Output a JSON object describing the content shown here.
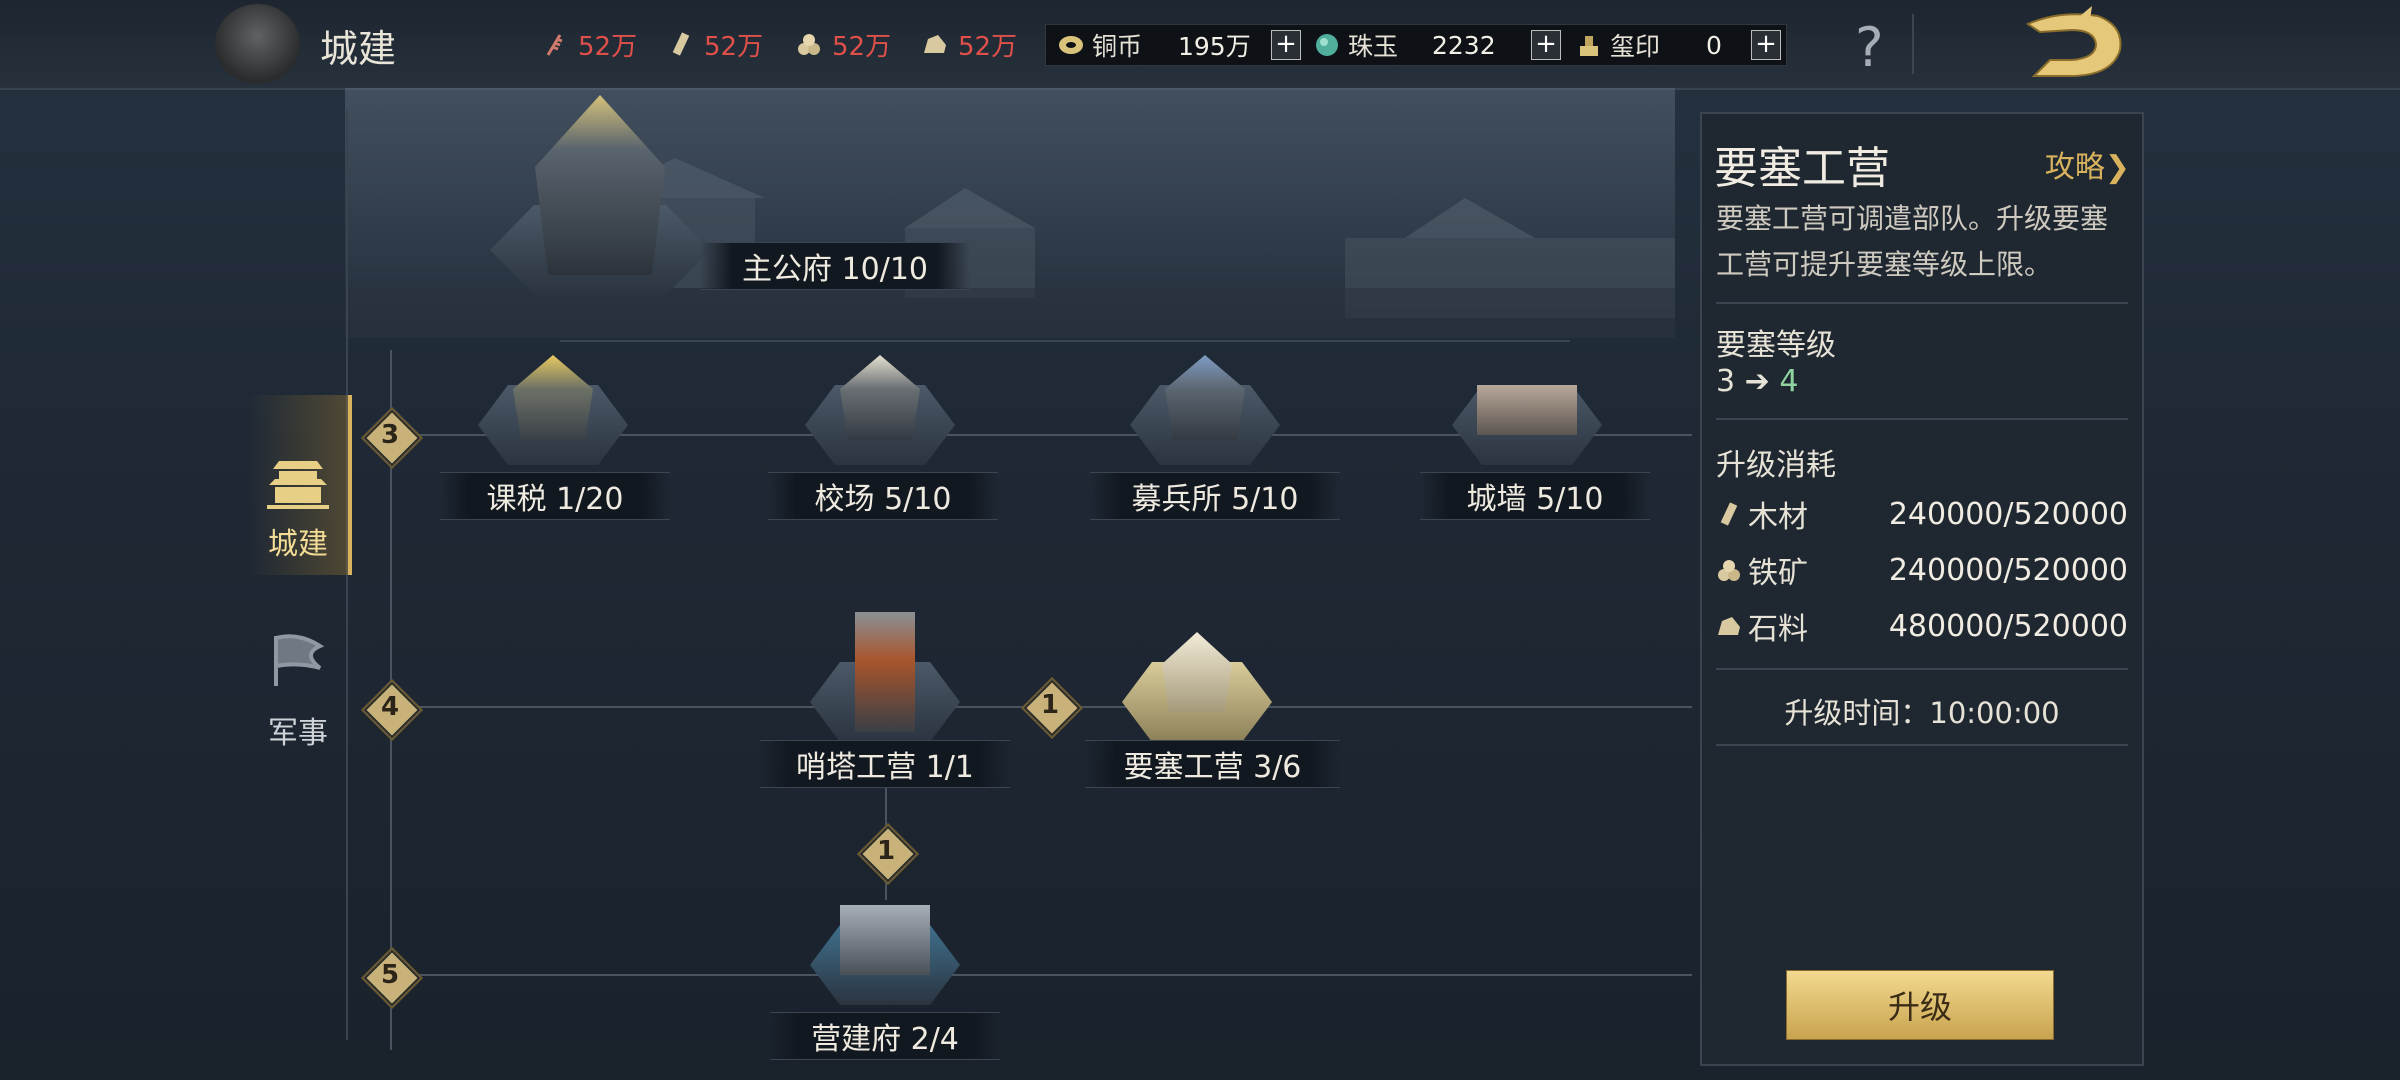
{
  "header": {
    "title": "城建",
    "resources": [
      {
        "icon": "grain-icon",
        "value": "52万"
      },
      {
        "icon": "wood-icon",
        "value": "52万"
      },
      {
        "icon": "iron-icon",
        "value": "52万"
      },
      {
        "icon": "stone-icon",
        "value": "52万"
      }
    ],
    "currencies": [
      {
        "icon": "copper-coin-icon",
        "label": "铜币",
        "value": "195万"
      },
      {
        "icon": "jade-icon",
        "label": "珠玉",
        "value": "2232"
      },
      {
        "icon": "seal-icon",
        "label": "玺印",
        "value": "0"
      }
    ],
    "plus_label": "+",
    "help_label": "?"
  },
  "nav": {
    "items": [
      {
        "label": "城建",
        "icon": "palace-icon",
        "active": true
      },
      {
        "label": "军事",
        "icon": "flag-icon",
        "active": false
      }
    ]
  },
  "tree": {
    "main": {
      "name": "主公府",
      "level": "10/10",
      "label": "主公府 10/10"
    },
    "tiers": [
      {
        "tier": "3",
        "buildings": [
          {
            "label": "课税 1/20"
          },
          {
            "label": "校场 5/10"
          },
          {
            "label": "募兵所 5/10"
          },
          {
            "label": "城墙 5/10"
          }
        ]
      },
      {
        "tier": "4",
        "buildings": [
          {
            "label": "哨塔工营 1/1"
          },
          {
            "label": "要塞工营 3/6"
          }
        ],
        "connector": "1"
      },
      {
        "tier": "5",
        "buildings": [
          {
            "label": "营建府 2/4"
          }
        ],
        "connector": "1"
      }
    ]
  },
  "panel": {
    "title": "要塞工营",
    "guide_link": "攻略",
    "description": "要塞工营可调遣部队。升级要塞工营可提升要塞等级上限。",
    "level_heading": "要塞等级",
    "level_from": "3",
    "level_arrow": "➔",
    "level_to": "4",
    "cost_heading": "升级消耗",
    "costs": [
      {
        "icon": "wood-icon",
        "name": "木材",
        "amount": "240000/520000"
      },
      {
        "icon": "iron-icon",
        "name": "铁矿",
        "amount": "240000/520000"
      },
      {
        "icon": "stone-icon",
        "name": "石料",
        "amount": "480000/520000"
      }
    ],
    "time_label": "升级时间：10:00:00",
    "upgrade_button": "升级"
  },
  "colors": {
    "accent_gold": "#d9b25d",
    "resource_red": "#e0504a",
    "level_green": "#8fd3a0"
  }
}
